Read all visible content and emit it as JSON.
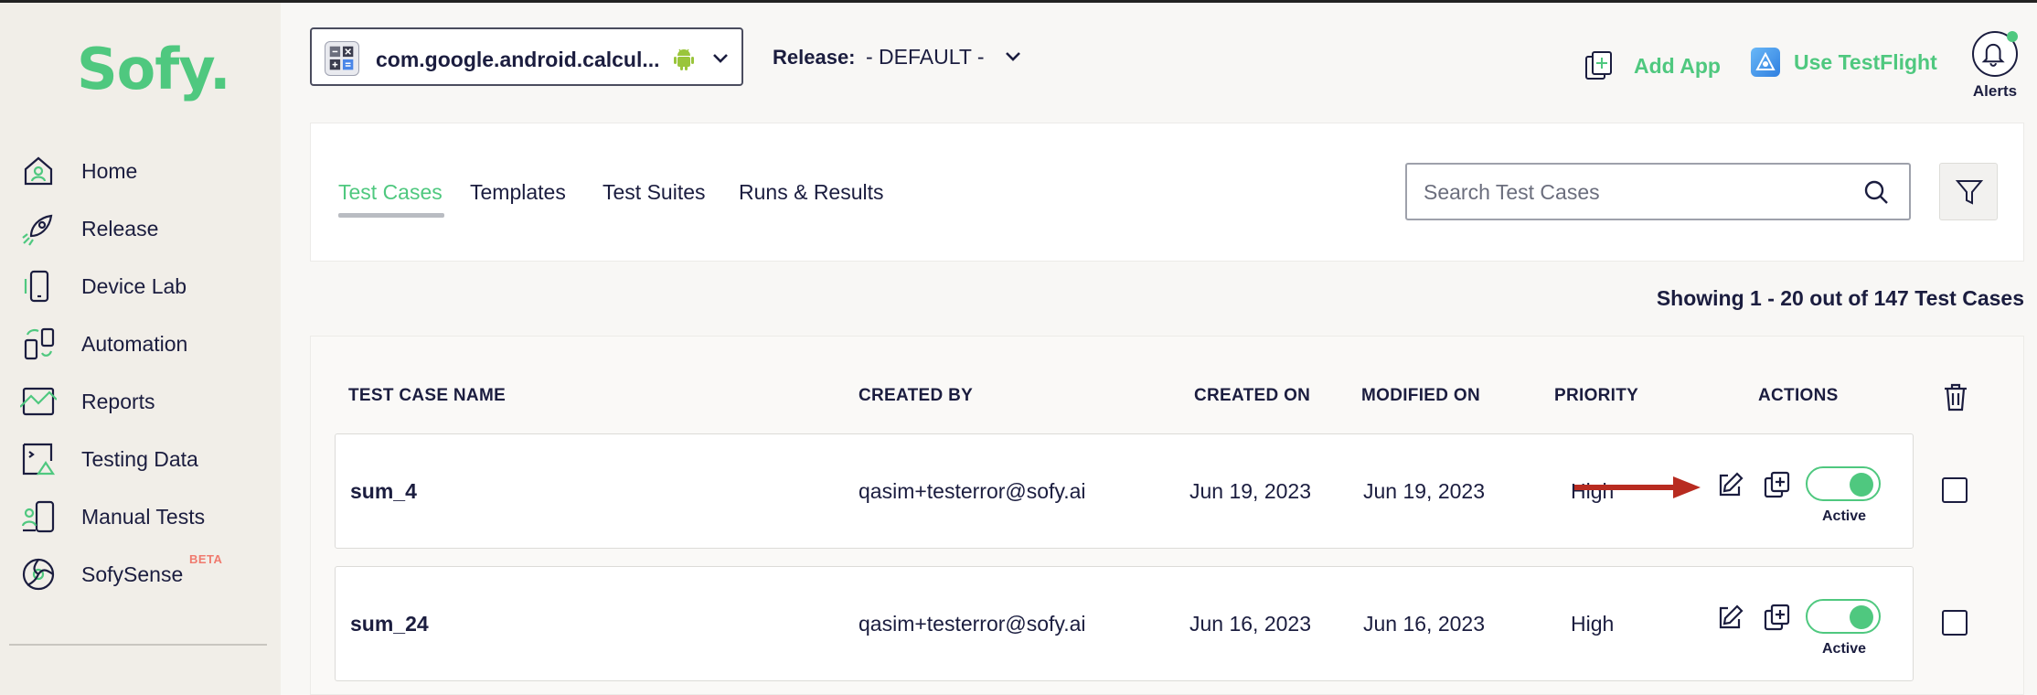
{
  "brand": {
    "logo": "Sofy.",
    "accent": "#4fc87f",
    "beta_color": "#f07a6e"
  },
  "sidebar": {
    "items": [
      {
        "label": "Home",
        "icon": "home-icon"
      },
      {
        "label": "Release",
        "icon": "rocket-icon"
      },
      {
        "label": "Device Lab",
        "icon": "phone-icon"
      },
      {
        "label": "Automation",
        "icon": "automation-icon"
      },
      {
        "label": "Reports",
        "icon": "reports-icon"
      },
      {
        "label": "Testing Data",
        "icon": "testing-data-icon"
      },
      {
        "label": "Manual Tests",
        "icon": "manual-tests-icon"
      },
      {
        "label": "SofySense",
        "icon": "sofysense-icon",
        "badge": "BETA"
      }
    ]
  },
  "header": {
    "app_name": "com.google.android.calcul...",
    "release_label": "Release:",
    "release_value": "- DEFAULT -",
    "add_app": "Add App",
    "testflight": "Use TestFlight",
    "alerts": "Alerts"
  },
  "tabs": [
    {
      "label": "Test Cases",
      "active": true
    },
    {
      "label": "Templates",
      "active": false
    },
    {
      "label": "Test Suites",
      "active": false
    },
    {
      "label": "Runs & Results",
      "active": false
    }
  ],
  "search": {
    "placeholder": "Search Test Cases",
    "value": ""
  },
  "showing": "Showing 1 - 20 out of 147 Test Cases",
  "table": {
    "columns": [
      "TEST CASE NAME",
      "CREATED BY",
      "CREATED ON",
      "MODIFIED ON",
      "PRIORITY",
      "ACTIONS"
    ],
    "rows": [
      {
        "name": "sum_4",
        "created_by": "qasim+testerror@sofy.ai",
        "created_on": "Jun 19, 2023",
        "modified_on": "Jun 19, 2023",
        "priority": "High",
        "status": "Active"
      },
      {
        "name": "sum_24",
        "created_by": "qasim+testerror@sofy.ai",
        "created_on": "Jun 16, 2023",
        "modified_on": "Jun 16, 2023",
        "priority": "High",
        "status": "Active"
      }
    ]
  }
}
